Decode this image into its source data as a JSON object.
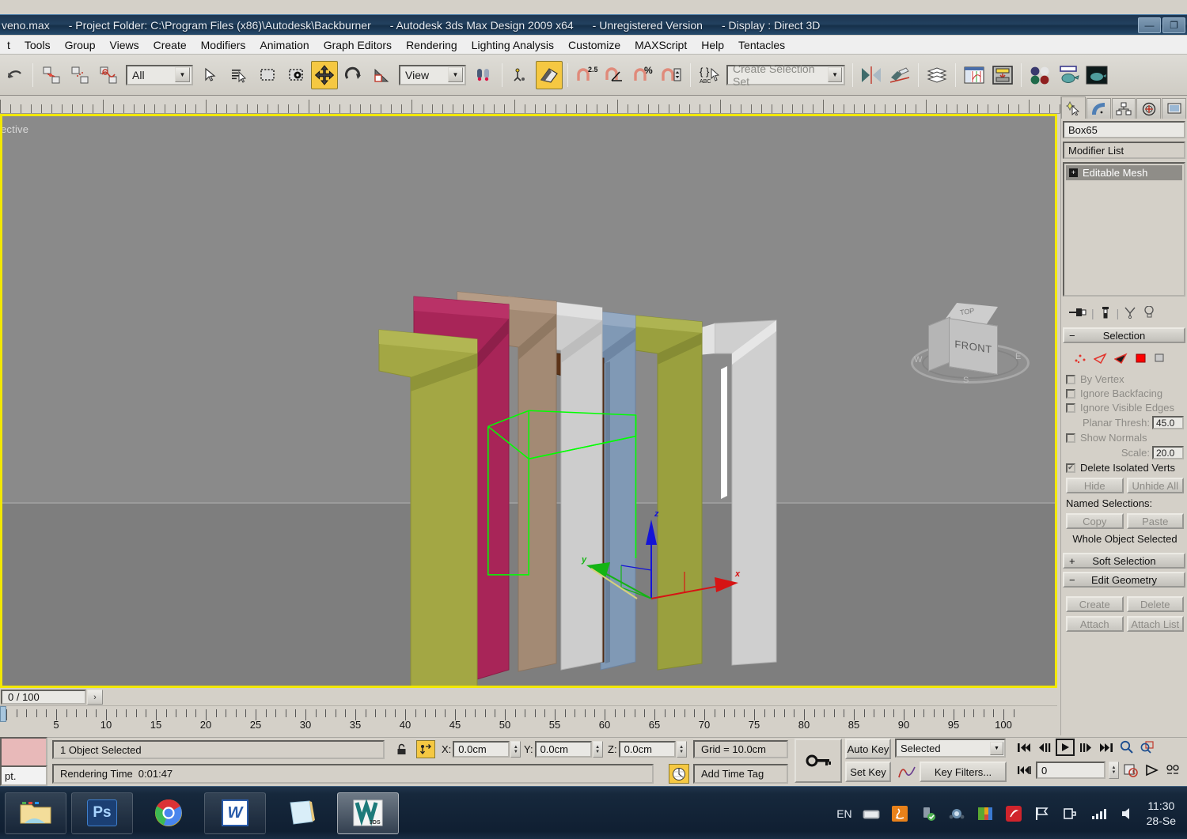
{
  "window": {
    "title_file": "veno.max",
    "title_project": "- Project Folder: C:\\Program Files (x86)\\Autodesk\\Backburner",
    "title_app": "- Autodesk 3ds Max Design 2009 x64",
    "title_license": "- Unregistered Version",
    "title_display": "- Display : Direct 3D",
    "btn_minimize": "—",
    "btn_restore": "❐",
    "btn_close": "✕"
  },
  "menu": {
    "items": [
      "t",
      "Tools",
      "Group",
      "Views",
      "Create",
      "Modifiers",
      "Animation",
      "Graph Editors",
      "Rendering",
      "Lighting Analysis",
      "Customize",
      "MAXScript",
      "Help",
      "Tentacles"
    ]
  },
  "toolbar": {
    "selection_filter": "All",
    "reference_coord": "View",
    "selection_set_placeholder": "Create Selection Set",
    "snap_angle_value": "2.5",
    "icons": [
      "undo-icon",
      "select-link-icon",
      "unlink-icon",
      "bind-space-warp-icon",
      "select-object-icon",
      "select-by-name-icon",
      "rectangular-region-icon",
      "window-crossing-icon",
      "select-and-move-icon",
      "select-and-rotate-icon",
      "select-and-scale-icon",
      "use-pivot-center-icon",
      "snap-toggle-icon",
      "angle-snap-icon",
      "percent-snap-icon",
      "spinner-snap-icon",
      "named-selection-icon",
      "mirror-icon",
      "align-icon",
      "layer-manager-icon",
      "curve-editor-icon",
      "schematic-view-icon",
      "material-editor-icon",
      "render-setup-icon",
      "render-frame-icon"
    ]
  },
  "viewport": {
    "label": "ective",
    "viewcube_front": "FRONT",
    "viewcube_top": "TOP",
    "gizmo_axes": [
      "x",
      "y",
      "z"
    ],
    "tripod_axis": "x",
    "books": [
      {
        "name": "book-olive-front",
        "color": "#a3a744"
      },
      {
        "name": "book-magenta",
        "color": "#a82558"
      },
      {
        "name": "book-tan",
        "color": "#a38a74"
      },
      {
        "name": "book-white",
        "color": "#cdcdcd"
      },
      {
        "name": "book-brown",
        "color": "#5c3318"
      },
      {
        "name": "book-blue",
        "color": "#8099b5"
      },
      {
        "name": "book-olive-back",
        "color": "#9aa03e"
      },
      {
        "name": "book-grey",
        "color": "#c2c2c2"
      }
    ],
    "selection_color": "#00ff00"
  },
  "timeslider": {
    "frame_readout": "0 / 100",
    "next_frame": "›"
  },
  "trackbar": {
    "ticks": [
      5,
      10,
      15,
      20,
      25,
      30,
      35,
      40,
      45,
      50,
      55,
      60,
      65,
      70,
      75,
      80,
      85,
      90,
      95,
      100
    ]
  },
  "status": {
    "prompt": "1 Object Selected",
    "render_time_label": "Rendering Time",
    "render_time_value": "0:01:47",
    "lock_icon": "lock-icon",
    "transform_icon": "absolute-mode-transform-icon",
    "x_label": "X:",
    "x_value": "0.0cm",
    "y_label": "Y:",
    "y_value": "0.0cm",
    "z_label": "Z:",
    "z_value": "0.0cm",
    "grid": "Grid = 10.0cm",
    "add_time_tag": "Add Time Tag",
    "auto_key": "Auto Key",
    "set_key": "Set Key",
    "key_mode": "Selected",
    "key_filters": "Key Filters...",
    "current_frame": "0"
  },
  "command_panel": {
    "tabs": [
      "create-tab-icon",
      "modify-tab-icon",
      "hierarchy-tab-icon",
      "motion-tab-icon",
      "display-tab-icon"
    ],
    "object_name": "Box65",
    "modifier_list": "Modifier List",
    "stack_entry": "Editable Mesh",
    "stack_expand": "+",
    "stack_buttons": [
      "pin-stack-icon",
      "show-end-result-icon",
      "make-unique-icon",
      "remove-modifier-icon"
    ],
    "rollouts": {
      "selection": {
        "title": "Selection",
        "sign": "−",
        "sub_object_modes": [
          "vertex-icon",
          "edge-icon",
          "face-icon",
          "polygon-icon",
          "element-icon"
        ],
        "checkboxes": [
          {
            "label": "By Vertex",
            "checked": false
          },
          {
            "label": "Ignore Backfacing",
            "checked": false
          },
          {
            "label": "Ignore Visible Edges",
            "checked": false
          }
        ],
        "planar_thresh_label": "Planar Thresh:",
        "planar_thresh_value": "45.0",
        "show_normals_label": "Show Normals",
        "show_normals_checked": false,
        "scale_label": "Scale:",
        "scale_value": "20.0",
        "delete_isolated_label": "Delete Isolated Verts",
        "delete_isolated_checked": true,
        "hide_button": "Hide",
        "unhide_button": "Unhide All",
        "named_selections_label": "Named Selections:",
        "copy_button": "Copy",
        "paste_button": "Paste",
        "status_text": "Whole Object Selected"
      },
      "soft_selection": {
        "title": "Soft Selection",
        "sign": "+"
      },
      "edit_geometry": {
        "title": "Edit Geometry",
        "sign": "−",
        "create_button": "Create",
        "delete_button": "Delete",
        "attach_button": "Attach",
        "attach_list_button": "Attach List"
      }
    }
  },
  "taskbar": {
    "items": [
      {
        "name": "windows-explorer-taskbar-icon",
        "label": "Explorer"
      },
      {
        "name": "photoshop-taskbar-icon",
        "label": "Ps"
      },
      {
        "name": "chrome-taskbar-icon",
        "label": "Chrome"
      },
      {
        "name": "word-taskbar-icon",
        "label": "W"
      },
      {
        "name": "sticky-notes-taskbar-icon",
        "label": ""
      },
      {
        "name": "3dsmax-taskbar-icon",
        "label": "3DS"
      }
    ],
    "tray": {
      "language": "EN",
      "icons": [
        "keyboard-layout-icon",
        "java-update-icon",
        "safely-remove-hardware-icon",
        "network-share-icon",
        "color-app-icon",
        "pdf-app-icon",
        "flag-action-center-icon",
        "power-plug-icon",
        "signal-bars-icon",
        "volume-icon"
      ],
      "time": "11:30",
      "date": "28-Se"
    }
  }
}
